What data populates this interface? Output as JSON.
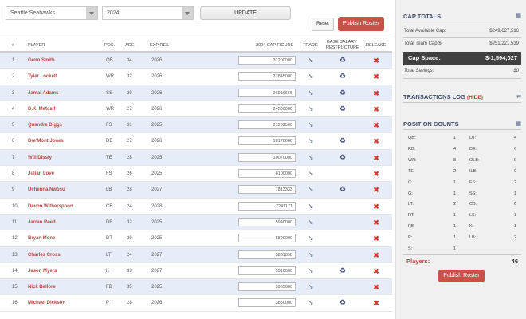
{
  "controls": {
    "team_select": "Seattle Seahawks",
    "year_select": "2024",
    "update_label": "UPDATE",
    "reset_label": "Reset",
    "publish_label": "Publish Roster"
  },
  "table": {
    "headers": {
      "num": "#",
      "player": "PLAYER",
      "pos": "POS.",
      "age": "AGE",
      "expires": "EXPIRES",
      "cap": "2024 CAP FIGURE",
      "trade": "TRADE",
      "restructure_line1": "BASE SALARY",
      "restructure_line2": "RESTRUCTURE",
      "release": "RELEASE"
    },
    "rows": [
      {
        "num": "1",
        "player": "Geno Smith",
        "pos": "QB",
        "age": "34",
        "expires": "2026",
        "cap": "31200000",
        "restructure": true
      },
      {
        "num": "2",
        "player": "Tyler Lockett",
        "pos": "WR",
        "age": "32",
        "expires": "2026",
        "cap": "27845000",
        "restructure": true
      },
      {
        "num": "3",
        "player": "Jamal Adams",
        "pos": "SS",
        "age": "29",
        "expires": "2026",
        "cap": "26916666",
        "restructure": true
      },
      {
        "num": "4",
        "player": "D.K. Metcalf",
        "pos": "WR",
        "age": "27",
        "expires": "2026",
        "cap": "24500000",
        "restructure": true
      },
      {
        "num": "5",
        "player": "Quandre Diggs",
        "pos": "FS",
        "age": "31",
        "expires": "2025",
        "cap": "21282500",
        "restructure": false
      },
      {
        "num": "6",
        "player": "Dre'Mont Jones",
        "pos": "DE",
        "age": "27",
        "expires": "2026",
        "cap": "18176666",
        "restructure": true
      },
      {
        "num": "7",
        "player": "Will Dissly",
        "pos": "TE",
        "age": "28",
        "expires": "2025",
        "cap": "10070000",
        "restructure": true
      },
      {
        "num": "8",
        "player": "Julian Love",
        "pos": "FS",
        "age": "26",
        "expires": "2025",
        "cap": "8100000",
        "restructure": false
      },
      {
        "num": "9",
        "player": "Uchenna Nwosu",
        "pos": "LB",
        "age": "28",
        "expires": "2027",
        "cap": "7813333",
        "restructure": true
      },
      {
        "num": "10",
        "player": "Devon Witherspoon",
        "pos": "CB",
        "age": "24",
        "expires": "2028",
        "cap": "7241171",
        "restructure": false
      },
      {
        "num": "11",
        "player": "Jarran Reed",
        "pos": "DE",
        "age": "32",
        "expires": "2025",
        "cap": "5940000",
        "restructure": false
      },
      {
        "num": "12",
        "player": "Bryan Mone",
        "pos": "DT",
        "age": "29",
        "expires": "2025",
        "cap": "5890000",
        "restructure": false
      },
      {
        "num": "13",
        "player": "Charles Cross",
        "pos": "LT",
        "age": "24",
        "expires": "2027",
        "cap": "5831898",
        "restructure": false
      },
      {
        "num": "14",
        "player": "Jason Myers",
        "pos": "K",
        "age": "33",
        "expires": "2027",
        "cap": "5510000",
        "restructure": true
      },
      {
        "num": "15",
        "player": "Nick Bellore",
        "pos": "FB",
        "age": "35",
        "expires": "2025",
        "cap": "3965000",
        "restructure": false
      },
      {
        "num": "16",
        "player": "Michael Dickson",
        "pos": "P",
        "age": "28",
        "expires": "2026",
        "cap": "3850000",
        "restructure": true
      }
    ]
  },
  "cap_totals": {
    "title": "CAP TOTALS",
    "available_label": "Total Available Cap:",
    "available_value": "$249,627,516",
    "team_cap_label": "Total Team Cap $:",
    "team_cap_value": "$251,221,539",
    "cap_space_label": "Cap Space:",
    "cap_space_value": "$-1,594,027",
    "savings_label": "Total Savings:",
    "savings_value": "$0"
  },
  "transactions": {
    "title": "TRANSACTIONS LOG",
    "hide_label": "(HIDE)"
  },
  "position_counts": {
    "title": "POSITION COUNTS",
    "left": [
      {
        "pos": "QB:",
        "count": "1"
      },
      {
        "pos": "RB:",
        "count": "4"
      },
      {
        "pos": "WR:",
        "count": "8"
      },
      {
        "pos": "TE:",
        "count": "2"
      },
      {
        "pos": "C:",
        "count": "1"
      },
      {
        "pos": "G:",
        "count": "1"
      },
      {
        "pos": "LT:",
        "count": "2"
      },
      {
        "pos": "RT:",
        "count": "1"
      },
      {
        "pos": "FB:",
        "count": "1"
      },
      {
        "pos": "P:",
        "count": "1"
      },
      {
        "pos": "S:",
        "count": "1"
      }
    ],
    "right": [
      {
        "pos": "DT:",
        "count": "4"
      },
      {
        "pos": "DE:",
        "count": "6"
      },
      {
        "pos": "OLB:",
        "count": "0"
      },
      {
        "pos": "ILB:",
        "count": "0"
      },
      {
        "pos": "FS:",
        "count": "2"
      },
      {
        "pos": "SS:",
        "count": "1"
      },
      {
        "pos": "CB:",
        "count": "6"
      },
      {
        "pos": "LS:",
        "count": "1"
      },
      {
        "pos": "K:",
        "count": "1"
      },
      {
        "pos": "LB:",
        "count": "2"
      }
    ],
    "players_label": "Players:",
    "players_value": "46",
    "publish_label": "Publish Roster"
  },
  "colors": {
    "accent_red": "#c9514a",
    "name_red": "#b34a44",
    "row_alt": "#e6edf8",
    "panel_title": "#3c4b6b"
  }
}
